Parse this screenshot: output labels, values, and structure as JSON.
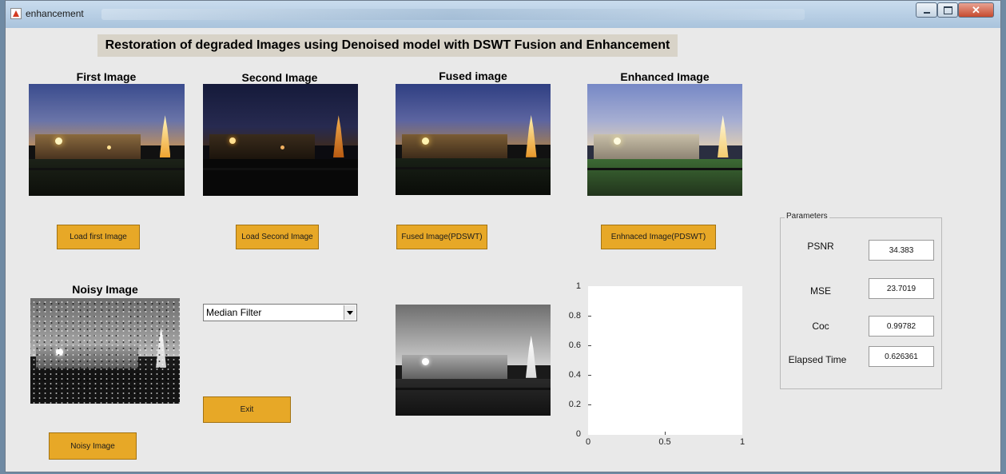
{
  "window": {
    "title": "enhancement"
  },
  "heading": "Restoration of degraded Images using Denoised model with DSWT Fusion and Enhancement",
  "captions": {
    "first": "First Image",
    "second": "Second Image",
    "fused": "Fused image",
    "enhanced": "Enhanced Image",
    "noisy": "Noisy Image"
  },
  "buttons": {
    "load_first": "Load first Image",
    "load_second": "Load Second Image",
    "fused": "Fused Image(PDSWT)",
    "enhanced": "Enhnaced Image(PDSWT)",
    "exit": "Exit",
    "noisy": "Noisy Image"
  },
  "filter_select": {
    "value": "Median Filter"
  },
  "axes": {
    "y_ticks": [
      "1",
      "0.8",
      "0.6",
      "0.4",
      "0.2",
      "0"
    ],
    "x_ticks": [
      "0",
      "0.5",
      "1"
    ]
  },
  "parameters": {
    "title": "Parameters",
    "psnr": {
      "label": "PSNR",
      "value": "34.383"
    },
    "mse": {
      "label": "MSE",
      "value": "23.7019"
    },
    "coc": {
      "label": "Coc",
      "value": "0.99782"
    },
    "elapsed": {
      "label": "Elapsed Time",
      "value": "0.626361"
    }
  }
}
